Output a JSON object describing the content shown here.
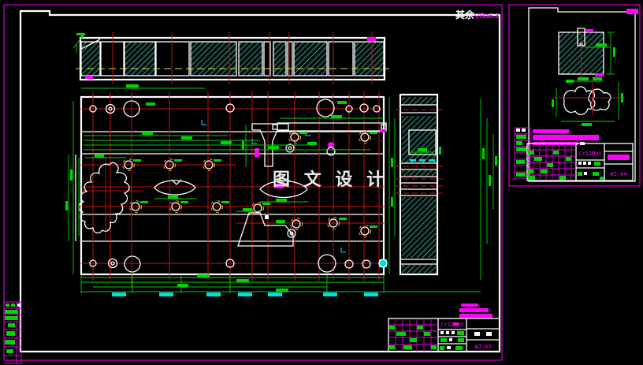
{
  "surface_note": {
    "prefix": "其余",
    "roughness": "▽Ra6.3"
  },
  "watermark": {
    "text": "图 文 设 计"
  },
  "main_sheet": {
    "title_block": {
      "material": "Cr12MoV",
      "drawing_no": "WJ-03"
    }
  },
  "detail_sheet": {
    "title_block": {
      "material": "Cr12MoV",
      "drawing_no": "WJ-04"
    }
  },
  "colors": {
    "background": "#000000",
    "outline": "#ffffff",
    "sheet_border": "#ff00ff",
    "centerline": "#c41212",
    "dimension": "#00d400",
    "hatch": "#74e6d2",
    "highlight": "#00e5ff",
    "strip_axis": "#d8e34a",
    "bolt_mark": "#ff8c00",
    "watermark": "#eaeaea"
  }
}
